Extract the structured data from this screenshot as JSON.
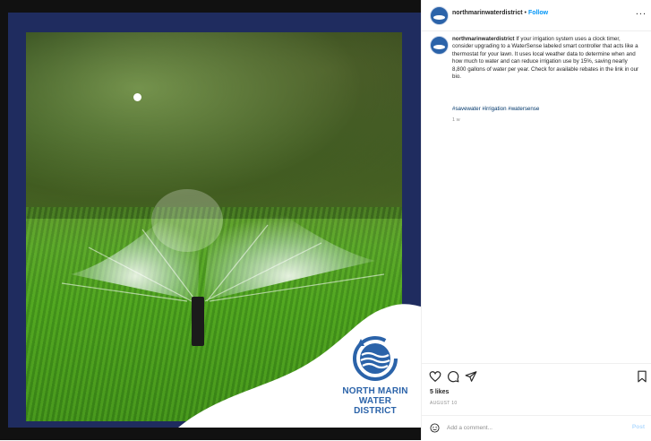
{
  "post": {
    "username": "northmarinwaterdistrict",
    "separator": "•",
    "follow_label": "Follow",
    "more_label": "...",
    "caption_text": "If your irrigation system uses a clock timer, consider upgrading to a WaterSense labeled smart controller that acts like a thermostat for your lawn. It uses local weather data to determine when and how much to water and can reduce irrigation use by 15%, saving nearly 8,800 gallons of water per year. Check for available rebates in the link in our bio.",
    "hashtags": "#savewater #irrigation #watersense",
    "time_ago": "1 w",
    "likes": "5 likes",
    "date": "AUGUST 10",
    "comment_placeholder": "Add a comment...",
    "post_label": "Post"
  },
  "logo": {
    "line1": "NORTH MARIN",
    "line2": "WATER DISTRICT"
  },
  "icons": {
    "like": "heart-icon",
    "comment": "comment-icon",
    "share": "paper-plane-icon",
    "save": "bookmark-icon",
    "emoji": "smiley-icon",
    "avatar": "water-drop-logo"
  },
  "colors": {
    "brand_blue": "#2b63a9",
    "frame_navy": "#1f2c5f",
    "follow_blue": "#0095f6",
    "hashtag": "#00376b"
  }
}
